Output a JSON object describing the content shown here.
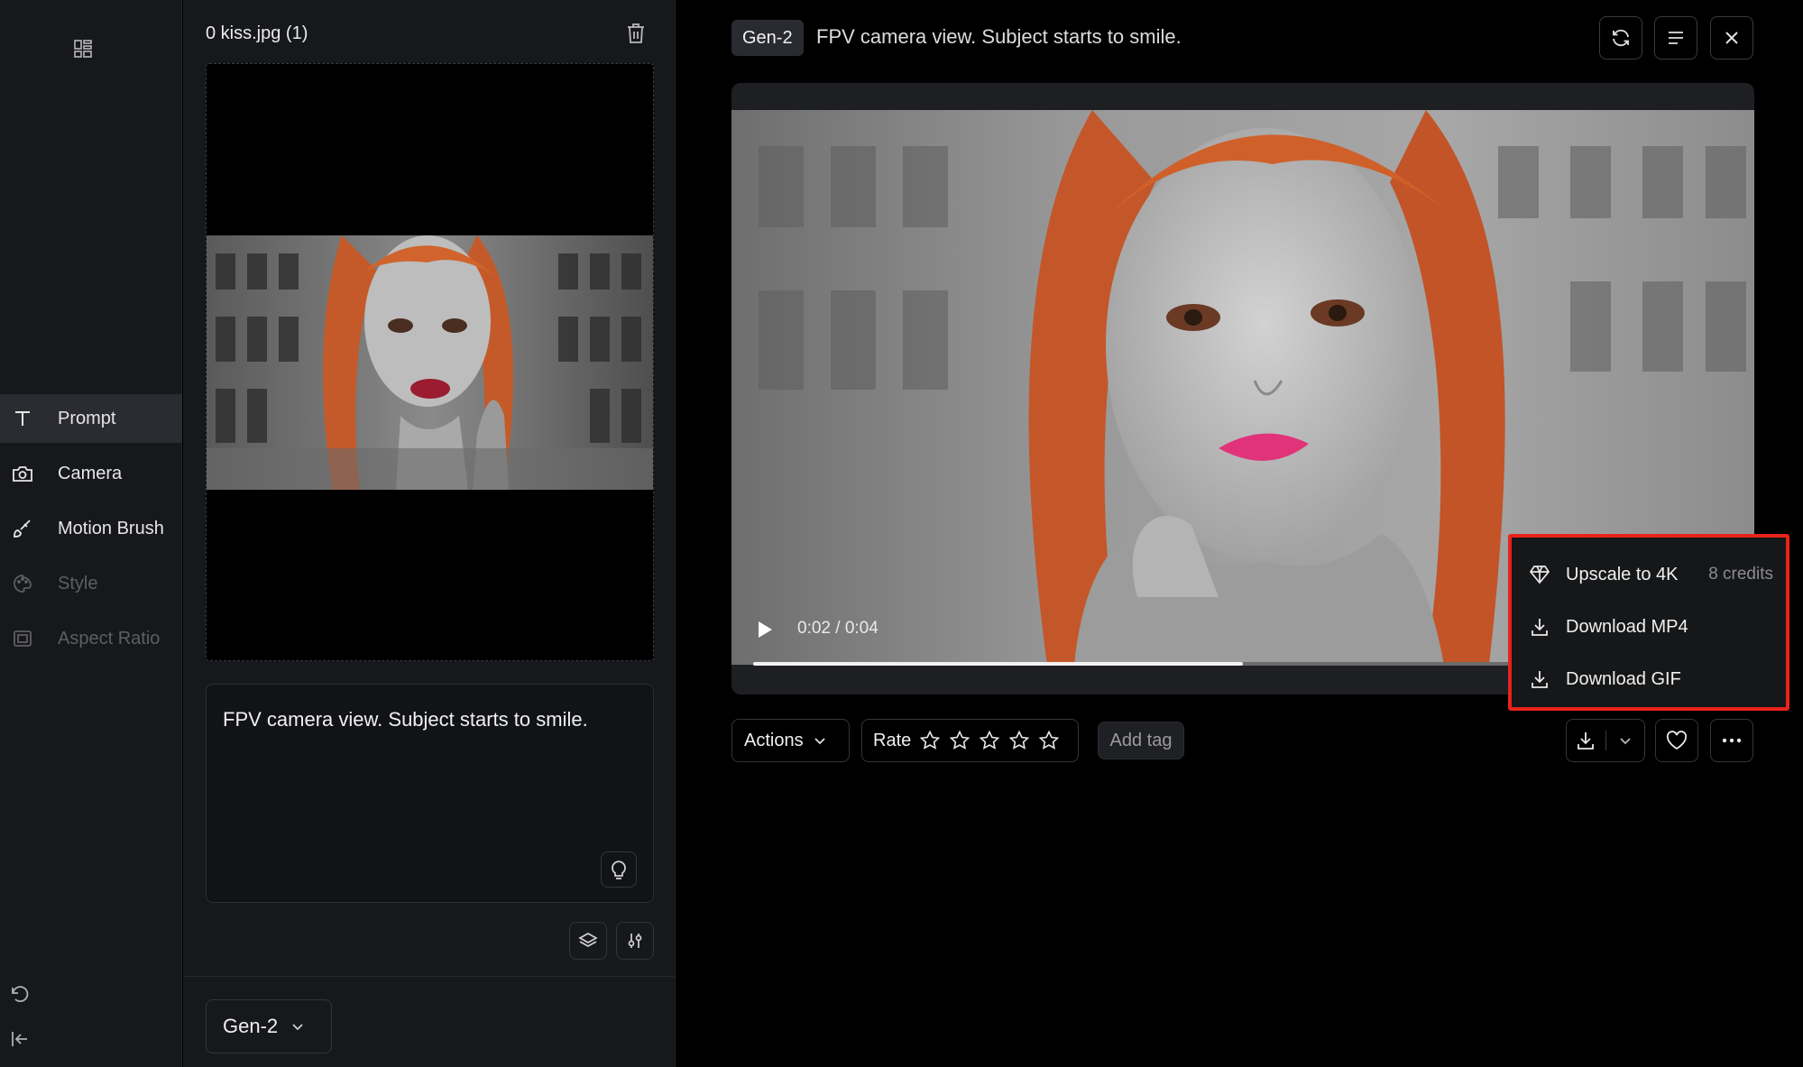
{
  "sidebar": {
    "items": [
      {
        "label": "Prompt",
        "icon": "text-icon",
        "active": true
      },
      {
        "label": "Camera",
        "icon": "camera-icon",
        "active": false
      },
      {
        "label": "Motion Brush",
        "icon": "brush-icon",
        "active": false
      },
      {
        "label": "Style",
        "icon": "palette-icon",
        "active": false,
        "disabled": true
      },
      {
        "label": "Aspect Ratio",
        "icon": "aspect-icon",
        "active": false,
        "disabled": true
      }
    ]
  },
  "panel": {
    "file_name": "0 kiss.jpg (1)",
    "prompt_text": "FPV camera view. Subject starts to smile.",
    "model": "Gen-2"
  },
  "header": {
    "badge": "Gen-2",
    "title": "FPV camera view. Subject starts to smile."
  },
  "player": {
    "time": "0:02 / 0:04",
    "progress": 0.5
  },
  "download_menu": {
    "items": [
      {
        "label": "Upscale to 4K",
        "icon": "diamond-icon",
        "extra": "8 credits"
      },
      {
        "label": "Download MP4",
        "icon": "download-icon"
      },
      {
        "label": "Download GIF",
        "icon": "download-icon"
      }
    ]
  },
  "toolbar": {
    "actions_label": "Actions",
    "rate_label": "Rate",
    "star_count": 5,
    "rating": 0,
    "add_tag_label": "Add tag"
  },
  "colors": {
    "highlight": "#e8231b",
    "background": "#000000",
    "panel": "#17181c"
  }
}
